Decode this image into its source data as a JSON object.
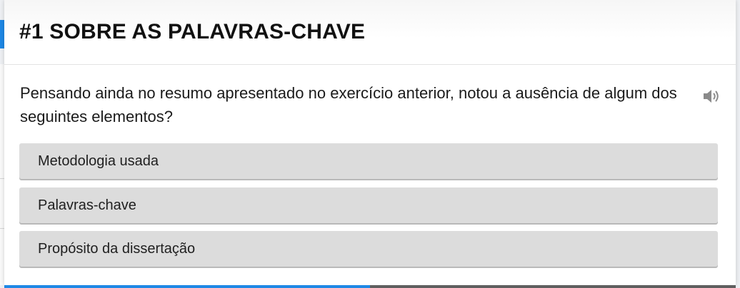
{
  "header": {
    "title": "#1 SOBRE AS PALAVRAS-CHAVE"
  },
  "question": {
    "text": "Pensando ainda no resumo apresentado no exercício anterior, notou a ausência de algum dos seguintes elementos?",
    "audio_icon": "speaker-icon"
  },
  "options": [
    {
      "label": "Metodologia usada"
    },
    {
      "label": "Palavras-chave"
    },
    {
      "label": "Propósito da dissertação"
    }
  ],
  "progress": {
    "fraction_complete": 0.5
  },
  "colors": {
    "accent": "#1e88e5",
    "option_bg": "#dcdcdc",
    "progress_rest": "#5f5f5f"
  }
}
